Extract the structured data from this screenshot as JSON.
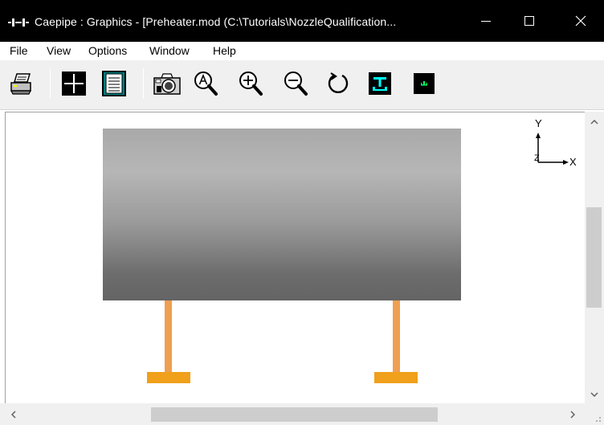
{
  "window": {
    "title": "Caepipe : Graphics -  [Preheater.mod (C:\\Tutorials\\NozzleQualification...",
    "controls": [
      "minimize",
      "maximize",
      "close"
    ]
  },
  "menu": {
    "items": [
      "File",
      "View",
      "Options",
      "Window",
      "Help"
    ]
  },
  "toolbar": {
    "buttons": [
      {
        "name": "print",
        "icon": "printer-icon"
      },
      {
        "name": "grid",
        "icon": "crosshair-grid-icon"
      },
      {
        "name": "list",
        "icon": "document-list-icon"
      },
      {
        "name": "snapshot",
        "icon": "camera-icon"
      },
      {
        "name": "zoom-all",
        "icon": "zoom-all-icon"
      },
      {
        "name": "zoom-in",
        "icon": "zoom-in-icon"
      },
      {
        "name": "zoom-out",
        "icon": "zoom-out-icon"
      },
      {
        "name": "rotate",
        "icon": "rotate-icon"
      },
      {
        "name": "supports-large",
        "icon": "support-symbol-icon"
      },
      {
        "name": "supports-small",
        "icon": "support-symbol-small-icon"
      }
    ]
  },
  "graphics": {
    "axes": {
      "y": "Y",
      "x": "X",
      "z": "Z"
    },
    "colors": {
      "vessel_top": "#a9a9a9",
      "vessel_bottom": "#646464",
      "support_leg": "#ef9f52",
      "support_base": "#f0a01a"
    }
  }
}
